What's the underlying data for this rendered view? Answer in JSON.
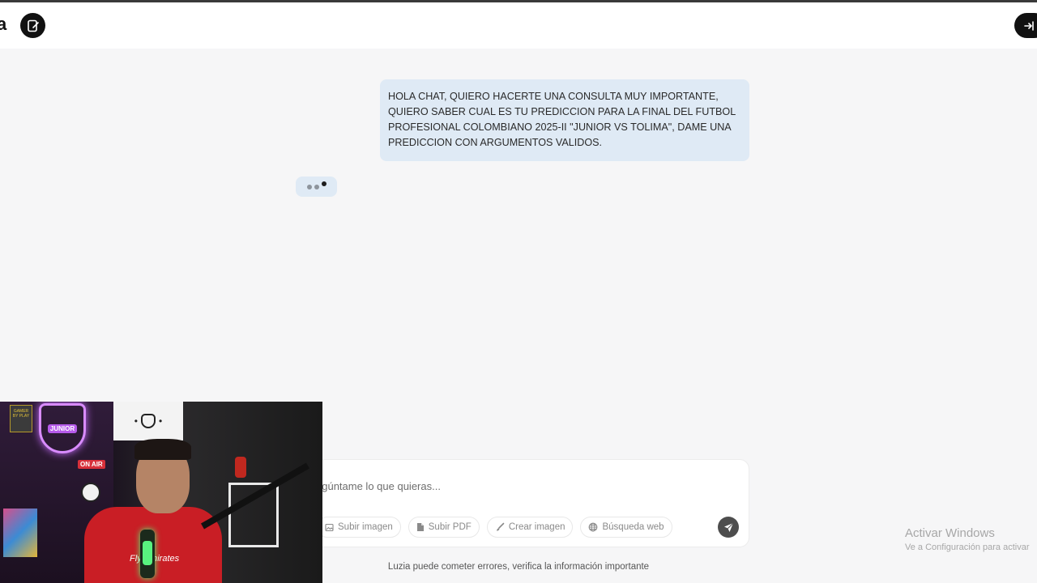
{
  "header": {
    "logo_fragment": "a",
    "new_chat_icon": "new-chat-icon",
    "login_icon": "login-icon"
  },
  "chat": {
    "user_message": "HOLA CHAT, QUIERO HACERTE UNA CONSULTA MUY IMPORTANTE, QUIERO SABER CUAL ES TU PREDICCION PARA LA FINAL DEL FUTBOL PROFESIONAL COLOMBIANO 2025-II \"JUNIOR VS TOLIMA\", DAME UNA PREDICCION CON ARGUMENTOS VALIDOS.",
    "typing_indicator": "typing-dots-icon"
  },
  "composer": {
    "placeholder": "Pregúntame lo que quieras...",
    "value": "",
    "tools": [
      {
        "label": "Subir imagen",
        "icon": "image-icon"
      },
      {
        "label": "Subir PDF",
        "icon": "pdf-icon"
      },
      {
        "label": "Crear imagen",
        "icon": "brush-icon"
      },
      {
        "label": "Búsqueda web",
        "icon": "globe-icon"
      }
    ],
    "send_icon": "send-icon"
  },
  "disclaimer": "Luzia puede cometer errores, verifica la información importante",
  "windows_watermark": {
    "title": "Activar Windows",
    "subtitle": "Ve a Configuración para activar"
  },
  "webcam": {
    "shield_text": "JUNIOR",
    "poster_text": "GAMER BY PLAY",
    "onair_text": "ON AIR",
    "shirt_text": "Fly Emirates"
  },
  "colors": {
    "background": "#f6f6f7",
    "user_bubble": "#dfeaf5",
    "send_button": "#4d4d4d",
    "header_button": "#111111"
  }
}
